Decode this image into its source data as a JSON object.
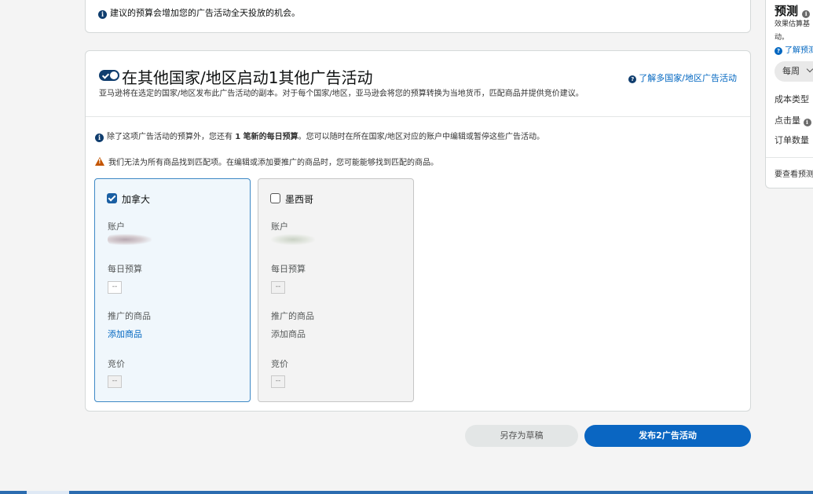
{
  "top_notice": {
    "text": "建议的预算会增加您的广告活动全天投放的机会。"
  },
  "multi_country": {
    "title": "在其他国家/地区启动1其他广告活动",
    "learn_more_link": "了解多国家/地区广告活动",
    "description": "亚马逊将在选定的国家/地区发布此广告活动的副本。对于每个国家/地区，亚马逊会将您的预算转换为当地货币，匹配商品并提供竞价建议。",
    "budget_notice": {
      "prefix": "除了这项广告活动的预算外，您还有 ",
      "bold": "1 笔新的每日预算",
      "suffix": "。您可以随时在所在国家/地区对应的账户中编辑或暂停这些广告活动。"
    },
    "warning": "我们无法为所有商品找到匹配项。在编辑或添加要推广的商品时，您可能能够找到匹配的商品。",
    "countries": [
      {
        "name": "加拿大",
        "checked": true,
        "account_label": "账户",
        "daily_budget_label": "每日预算",
        "daily_budget_value": "--",
        "products_label": "推广的商品",
        "add_products": "添加商品",
        "bid_label": "竞价",
        "bid_value": "--"
      },
      {
        "name": "墨西哥",
        "checked": false,
        "account_label": "账户",
        "daily_budget_label": "每日预算",
        "daily_budget_value": "--",
        "products_label": "推广的商品",
        "add_products": "添加商品",
        "bid_label": "竞价",
        "bid_value": "--"
      }
    ]
  },
  "actions": {
    "save_draft": "另存为草稿",
    "publish": "发布2广告活动"
  },
  "forecast": {
    "title": "预测",
    "desc_line1": "效果估算基",
    "desc_line2": "动。",
    "learn_link": "了解预测",
    "period_select": "每周",
    "cost_type_label": "成本类型",
    "clicks_label": "点击量",
    "orders_label": "订单数量",
    "view_note": "要查看预测"
  },
  "colors": {
    "primary": "#0a66c2",
    "link": "#0066c0",
    "selected_border": "#3d88c5"
  }
}
